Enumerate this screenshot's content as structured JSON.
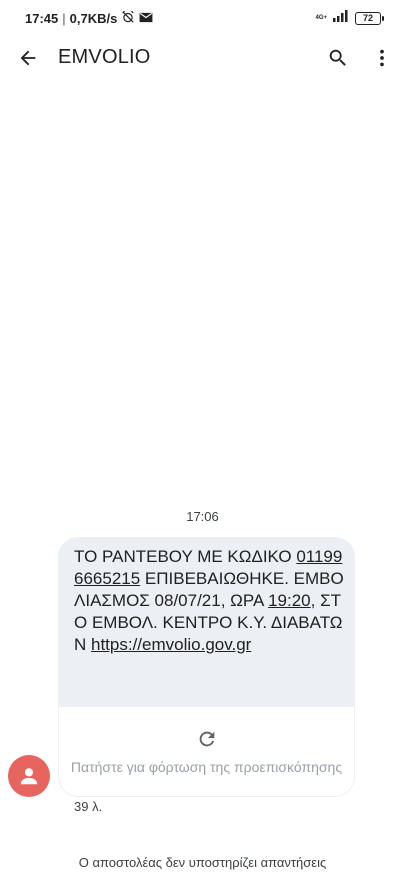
{
  "status_bar": {
    "time": "17:45",
    "separator": "|",
    "network_speed": "0,7KB/s",
    "network_label": "4G+",
    "battery_level": "72",
    "icons": [
      "alarm-off-icon",
      "mail-icon",
      "signal-icon",
      "battery-icon"
    ]
  },
  "app_bar": {
    "title": "EMVOLIO",
    "icons": [
      "back-arrow-icon",
      "search-icon",
      "more-vert-icon"
    ]
  },
  "conversation": {
    "timestamp": "17:06",
    "message": {
      "line_1": "ΤΟ ΡΑΝΤΕΒΟΥ ΜΕ ΚΩΔΙΚΟ ",
      "code": "011996665215",
      "line_2": " ΕΠΙΒΕΒΑΙΩΘΗΚΕ. ΕΜΒΟΛΙΑΣΜΟΣ 08/07/21, ΩΡΑ ",
      "time": "19:20",
      "line_3": ", ΣΤΟ ΕΜΒΟΛ. ΚΕΝΤΡΟ Κ.Υ. ΔΙΑΒΑΤΩΝ ",
      "link": "https://emvolio.gov.gr"
    },
    "preview": {
      "text": "Πατήστε για φόρτωση της προεπισκόπησης",
      "icon": "reload-icon"
    },
    "char_count": "39 λ.",
    "footer_note": "Ο αποστολέας δεν υποστηρίζει απαντήσεις"
  },
  "colors": {
    "bubble": "#eceff3",
    "avatar": "#e8645f",
    "preview_text": "#9aa0a6"
  }
}
